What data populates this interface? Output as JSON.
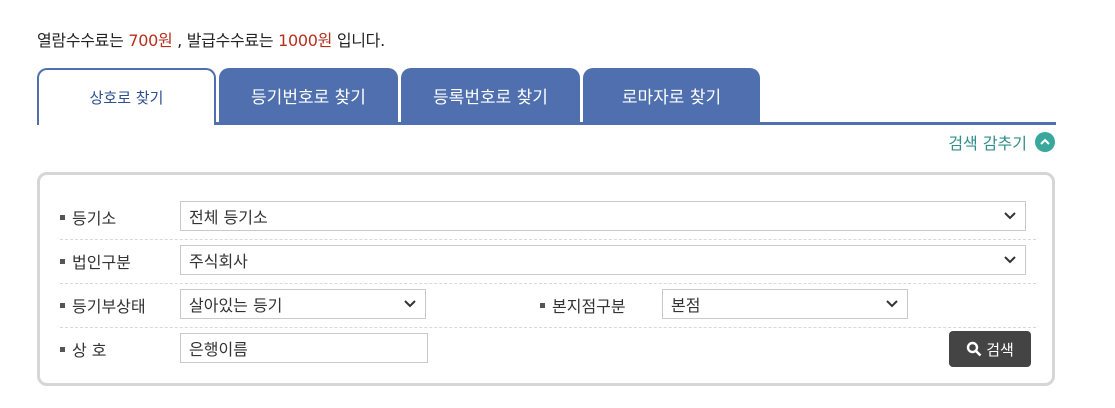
{
  "fee": {
    "prefix": "열람수수료는",
    "view_fee": "700원",
    "middle": " , 발급수수료는",
    "issue_fee": "1000원",
    "suffix": "입니다."
  },
  "tabs": [
    {
      "label": "상호로 찾기",
      "active": true
    },
    {
      "label": "등기번호로 찾기",
      "active": false
    },
    {
      "label": "등록번호로 찾기",
      "active": false
    },
    {
      "label": "로마자로 찾기",
      "active": false
    }
  ],
  "toggle": {
    "label": "검색 감추기",
    "icon": "chevron-up-circle-icon"
  },
  "form": {
    "registry_office": {
      "label": "등기소",
      "value": "전체 등기소"
    },
    "corp_type": {
      "label": "법인구분",
      "value": "주식회사"
    },
    "reg_status": {
      "label": "등기부상태",
      "value": "살아있는 등기"
    },
    "branch_type": {
      "label": "본지점구분",
      "value": "본점"
    },
    "trade_name": {
      "label": "상 호",
      "value": "은행이름"
    },
    "search_button": "검색"
  },
  "colors": {
    "tab_blue": "#4f6fae",
    "fee_red": "#b5301f",
    "toggle_teal": "#3aa79c",
    "button_dark": "#444444"
  }
}
